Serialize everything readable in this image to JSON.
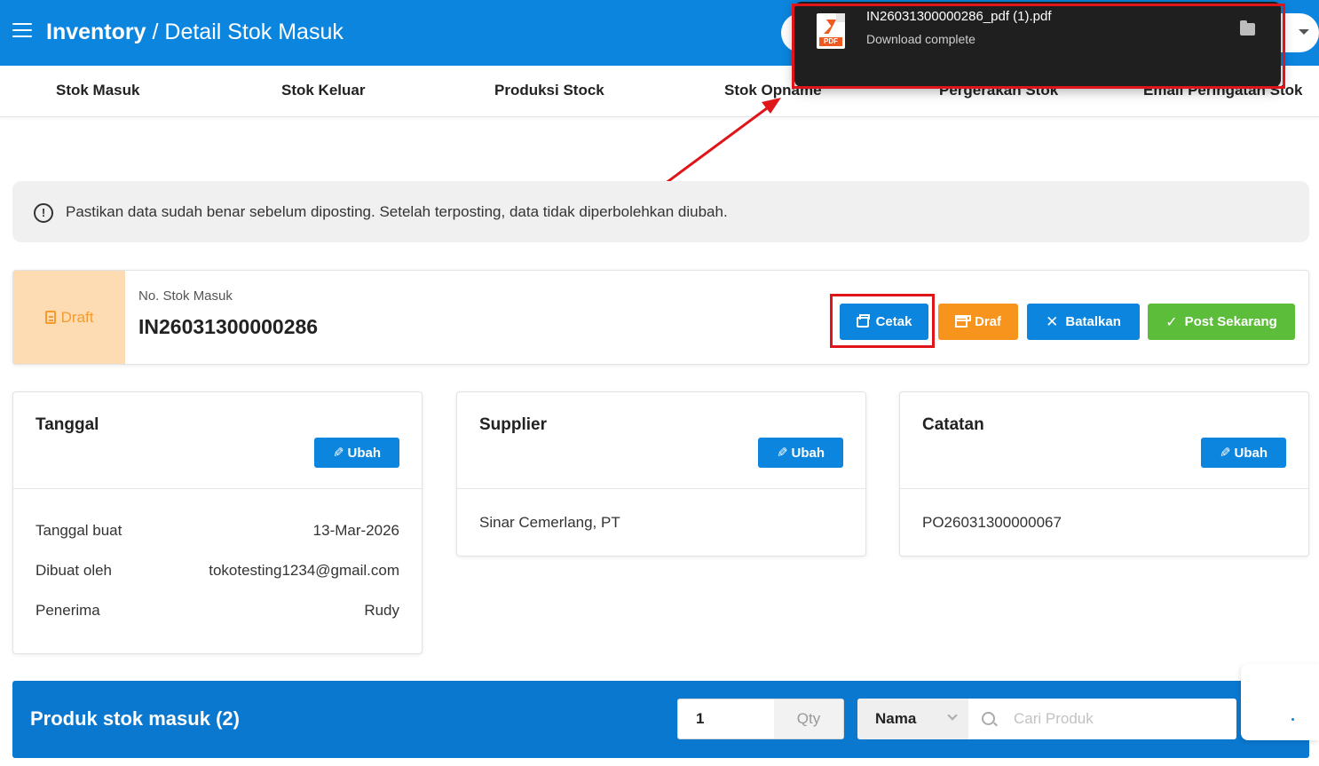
{
  "header": {
    "breadcrumb_root": "Inventory",
    "breadcrumb_sep": "/",
    "breadcrumb_current": "Detail Stok Masuk"
  },
  "tabs": [
    {
      "label": "Stok Masuk"
    },
    {
      "label": "Stok Keluar"
    },
    {
      "label": "Produksi Stock"
    },
    {
      "label": "Stok Opname"
    },
    {
      "label": "Pergerakan Stok"
    },
    {
      "label": "Email Peringatan Stok"
    }
  ],
  "download": {
    "filename": "IN26031300000286_pdf (1).pdf",
    "status": "Download complete",
    "file_icon_label": "PDF"
  },
  "alert": {
    "icon": "!",
    "text": "Pastikan data sudah benar sebelum diposting. Setelah terposting, data tidak diperbolehkan diubah."
  },
  "document": {
    "status_badge": "Draft",
    "number_label": "No. Stok Masuk",
    "number": "IN26031300000286"
  },
  "actions": {
    "cetak": "Cetak",
    "draf": "Draf",
    "batalkan": "Batalkan",
    "post": "Post Sekarang"
  },
  "cards": {
    "tanggal": {
      "title": "Tanggal",
      "edit": "Ubah",
      "rows": [
        {
          "label": "Tanggal buat",
          "value": "13-Mar-2026"
        },
        {
          "label": "Dibuat oleh",
          "value": "tokotesting1234@gmail.com"
        },
        {
          "label": "Penerima",
          "value": "Rudy"
        }
      ]
    },
    "supplier": {
      "title": "Supplier",
      "edit": "Ubah",
      "value": "Sinar Cemerlang, PT"
    },
    "catatan": {
      "title": "Catatan",
      "edit": "Ubah",
      "value": "PO26031300000067"
    }
  },
  "products": {
    "title": "Produk stok masuk (2)",
    "qty_value": "1",
    "qty_unit": "Qty",
    "search_by": "Nama",
    "search_placeholder": "Cari Produk"
  },
  "colors": {
    "primary": "#0b85de",
    "orange": "#f7941d",
    "green": "#5cbd3a",
    "draft_bg": "#fddbb3",
    "annotation_red": "#e0151a"
  }
}
